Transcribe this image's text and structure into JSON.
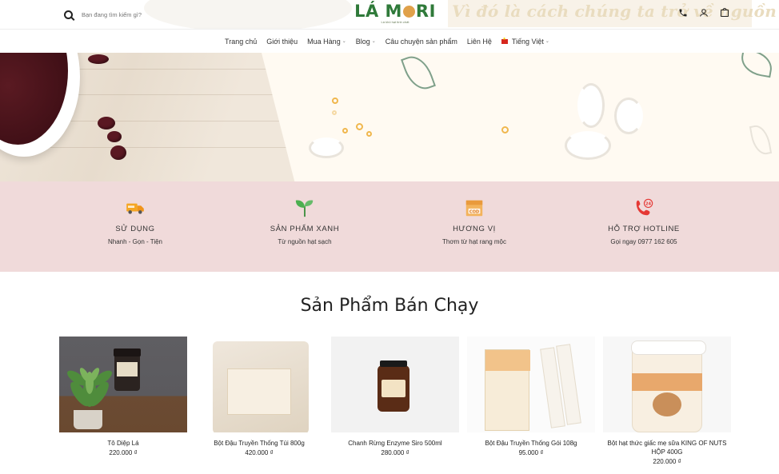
{
  "header": {
    "search_placeholder": "Bạn đang tìm kiếm gì?",
    "logo_text_left": "LÁ M",
    "logo_text_right": "RI",
    "logo_tagline": "Lá khô hạt tinh chất",
    "slogan": "Vì đó là cách chúng ta trở về nguồn cội",
    "icons": [
      "phone-icon",
      "user-icon",
      "cart-icon"
    ]
  },
  "nav": {
    "items": [
      {
        "label": "Trang chủ",
        "has_dropdown": false
      },
      {
        "label": "Giới thiệu",
        "has_dropdown": false
      },
      {
        "label": "Mua Hàng",
        "has_dropdown": true
      },
      {
        "label": "Blog",
        "has_dropdown": true
      },
      {
        "label": "Câu chuyện sản phẩm",
        "has_dropdown": false
      },
      {
        "label": "Liên Hệ",
        "has_dropdown": false
      }
    ],
    "language": "Tiếng Việt"
  },
  "features": [
    {
      "icon": "delivery-truck-icon",
      "title": "SỬ DỤNG",
      "subtitle": "Nhanh - Gọn - Tiện"
    },
    {
      "icon": "sprout-icon",
      "title": "SẢN PHẨM XANH",
      "subtitle": "Từ nguồn hạt sạch"
    },
    {
      "icon": "cod-box-icon",
      "title": "HƯƠNG VỊ",
      "subtitle": "Thơm từ hạt rang mộc"
    },
    {
      "icon": "phone-24-icon",
      "title": "HỖ TRỢ HOTLINE",
      "subtitle": "Gọi ngay 0977 162 605"
    }
  ],
  "section": {
    "title": "Sản Phẩm Bán Chạy"
  },
  "products": [
    {
      "name": "Tô Diệp Lá",
      "price": "220.000 ₫"
    },
    {
      "name": "Bột Đậu Truyền Thống Túi 800g",
      "price": "420.000 ₫"
    },
    {
      "name": "Chanh Rừng Enzyme Siro 500ml",
      "price": "280.000 ₫"
    },
    {
      "name": "Bột Đậu Truyền Thống Gói 108g",
      "price": "95.000 ₫"
    },
    {
      "name": "Bột hạt thức giấc mẹ sữa KING OF NUTS HỘP 400G",
      "price": "220.000 ₫"
    }
  ],
  "colors": {
    "brand_green": "#2f7a3a",
    "features_bg": "#f0dada",
    "hero_bg": "#fffaf2"
  }
}
